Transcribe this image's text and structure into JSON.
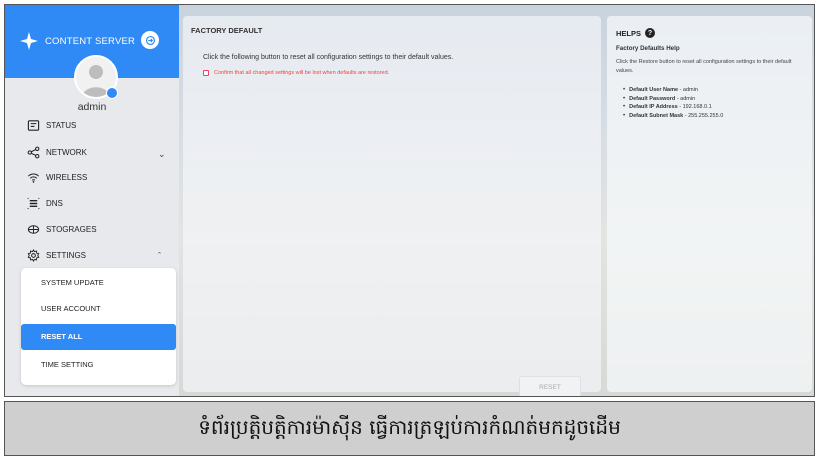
{
  "app": {
    "brand": "CONTENT SERVER",
    "user": "admin"
  },
  "colors": {
    "accent": "#2f8af5",
    "warning": "#e43c3c"
  },
  "sidebar": {
    "items": [
      {
        "label": "STATUS",
        "icon": "status-icon"
      },
      {
        "label": "NETWORK",
        "icon": "network-icon",
        "expandable": true
      },
      {
        "label": "WIRELESS",
        "icon": "wifi-icon"
      },
      {
        "label": "DNS",
        "icon": "dns-icon"
      },
      {
        "label": "STOGRAGES",
        "icon": "storage-icon"
      },
      {
        "label": "SETTINGS",
        "icon": "gear-icon",
        "expanded": true
      }
    ],
    "settings_submenu": [
      {
        "label": "SYSTEM UPDATE"
      },
      {
        "label": "USER ACCOUNT"
      },
      {
        "label": "RESET ALL",
        "active": true
      },
      {
        "label": "TIME SETTING"
      }
    ]
  },
  "main": {
    "title": "FACTORY DEFAULT",
    "description": "Click the following button to reset all configuration settings to their default values.",
    "confirm_label": "Confirm that all changed settings will be lost when defaults are restored.",
    "reset_label": "RESET"
  },
  "help": {
    "title": "HELPS",
    "subtitle": "Factory Defaults Help",
    "description": "Click the Restore button to reset all configuration settings to their default values.",
    "defaults": [
      {
        "name": "Default User Name",
        "value": " - admin"
      },
      {
        "name": "Default Password",
        "value": " - admin"
      },
      {
        "name": "Default IP Address",
        "value": " - 192.168.0.1"
      },
      {
        "name": "Default Subnet Mask",
        "value": " - 255.255.255.0"
      }
    ]
  },
  "caption": "ទំព័រប្រត្តិបត្តិការម៉ាស៊ីន ធ្វើការត្រឡប់ការកំណត់មកដូចដើម"
}
